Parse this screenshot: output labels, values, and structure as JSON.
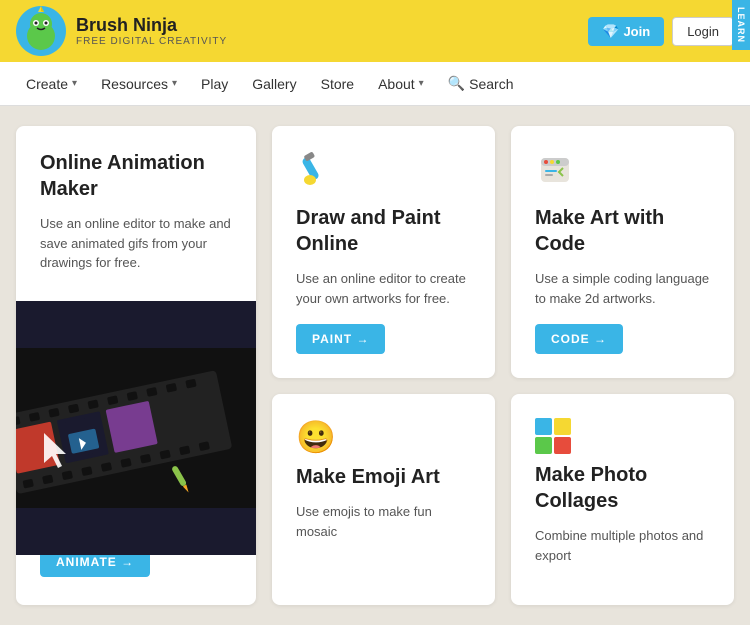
{
  "header": {
    "logo_title": "Brush Ninja",
    "logo_subtitle": "FREE DIGITAL CREATIVITY",
    "side_tab": "LEARN",
    "btn_join": "Join",
    "btn_login": "Login"
  },
  "nav": {
    "items": [
      {
        "label": "Create",
        "has_dropdown": true
      },
      {
        "label": "Resources",
        "has_dropdown": true
      },
      {
        "label": "Play",
        "has_dropdown": false
      },
      {
        "label": "Gallery",
        "has_dropdown": false
      },
      {
        "label": "Store",
        "has_dropdown": false
      },
      {
        "label": "About",
        "has_dropdown": true
      },
      {
        "label": "Search",
        "has_dropdown": false,
        "is_search": true
      }
    ]
  },
  "cards": {
    "card1": {
      "title": "Online Animation Maker",
      "desc": "Use an online editor to make and save animated gifs from your drawings for free.",
      "btn": "ANIMATE →"
    },
    "card2": {
      "title": "Draw and Paint Online",
      "desc": "Use an online editor to create your own artworks for free.",
      "btn": "PAINT →"
    },
    "card3": {
      "title": "Make Art with Code",
      "desc": "Use a simple coding language to make 2d artworks.",
      "btn": "CODE →"
    },
    "card4": {
      "title": "Make Emoji Art",
      "desc": "Use emojis to make fun mosaic"
    },
    "card5": {
      "title": "Make Photo Collages",
      "desc": "Combine multiple photos and export"
    }
  }
}
